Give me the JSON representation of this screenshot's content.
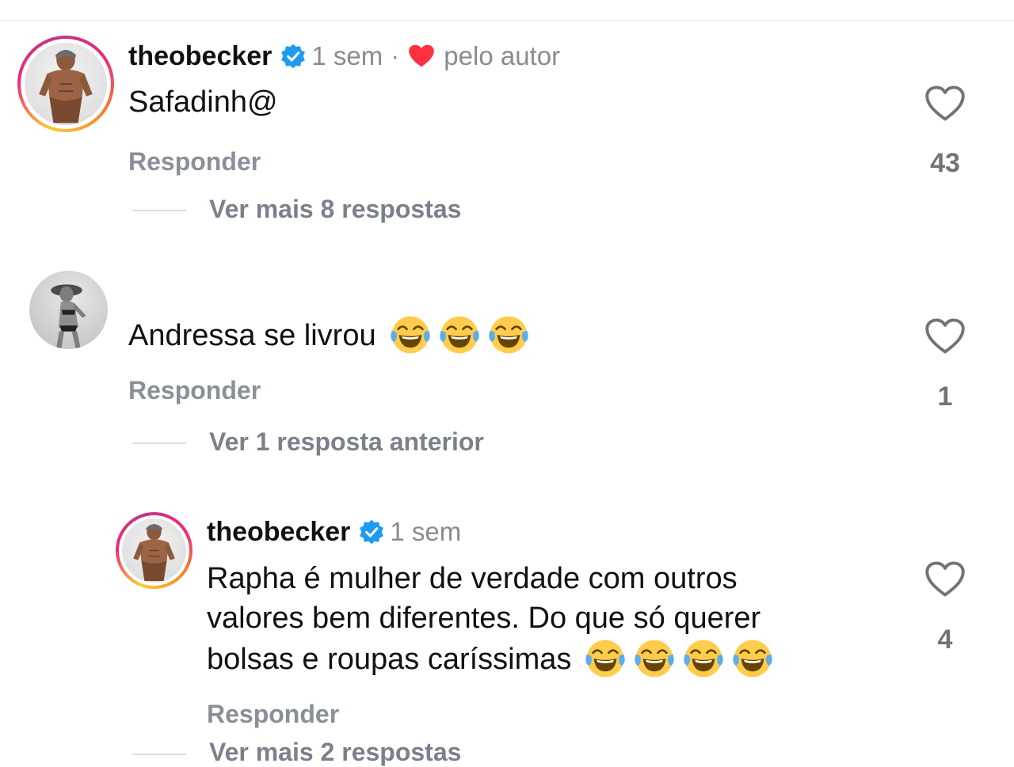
{
  "comments": [
    {
      "username": "theobecker",
      "verified": true,
      "time": "1 sem",
      "separator": "·",
      "author_like": "pelo autor",
      "text": "Safadinh@",
      "reply_label": "Responder",
      "like_count": "43",
      "thread_label": "Ver mais 8 respostas"
    },
    {
      "text": "Andressa se livrou",
      "emoji_count": 3,
      "reply_label": "Responder",
      "like_count": "1",
      "thread_label": "Ver 1 resposta anterior"
    },
    {
      "username": "theobecker",
      "verified": true,
      "time": "1 sem",
      "text_line1": "Rapha é mulher de verdade com outros",
      "text_line2": "valores bem diferentes. Do que só querer",
      "text_line3": "bolsas e roupas caríssimas",
      "emoji_count": 4,
      "reply_label": "Responder",
      "like_count": "4",
      "thread_label": "Ver mais 2 respostas"
    }
  ],
  "icons": {
    "like": "heart-outline-icon",
    "verified": "verified-badge-icon",
    "author_heart": "red-heart-icon",
    "emoji": "face-with-tears-of-joy"
  },
  "colors": {
    "verified_blue": "#1d9bf0",
    "author_heart_red": "#ff3040",
    "secondary_text": "#8a8a8f"
  }
}
